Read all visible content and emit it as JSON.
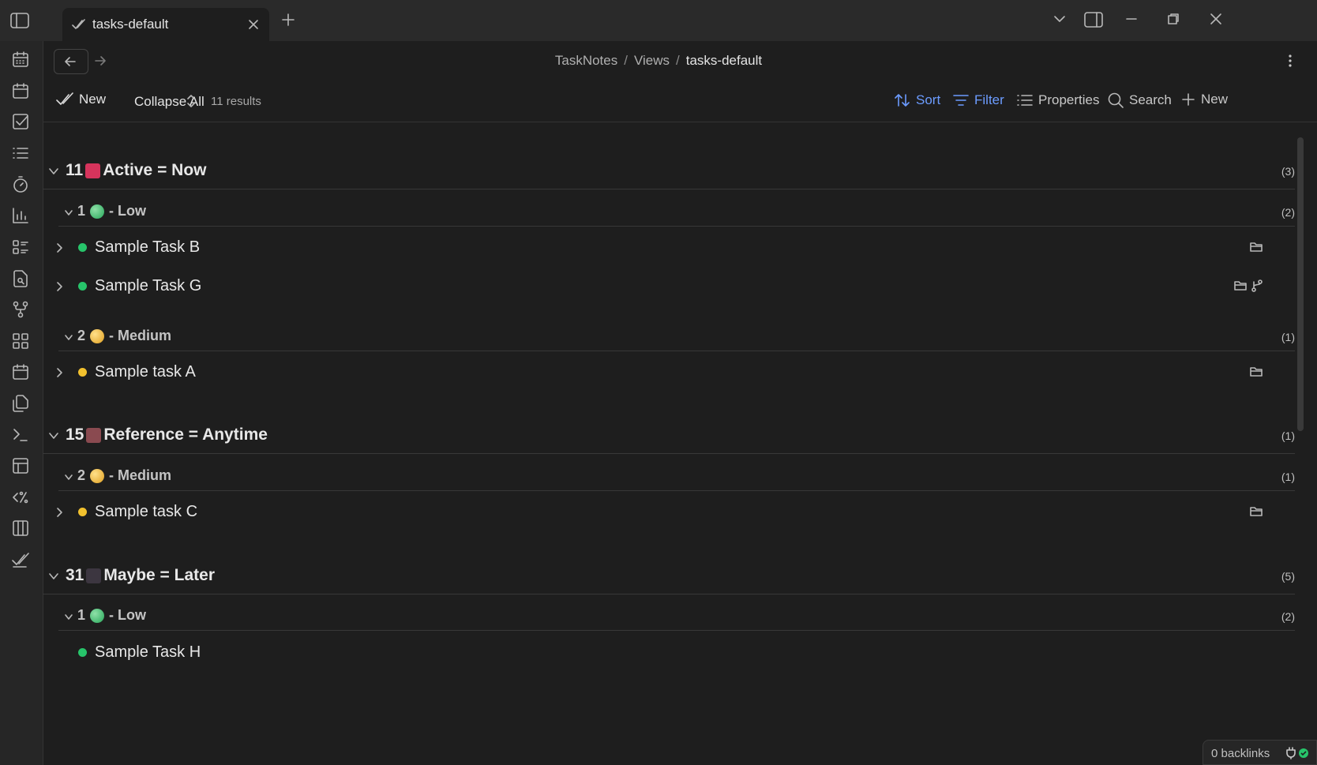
{
  "tab": {
    "title": "tasks-default"
  },
  "breadcrumb": {
    "root": "TaskNotes",
    "folder": "Views",
    "current": "tasks-default",
    "separator": "/"
  },
  "toolbar": {
    "new_label": "New",
    "collapse_label": "Collapse All",
    "results": "11 results",
    "sort_label": "Sort",
    "filter_label": "Filter",
    "properties_label": "Properties",
    "search_label": "Search",
    "new_right_label": "New"
  },
  "groups": [
    {
      "num": "11",
      "label": "Active = Now",
      "count": "(3)",
      "color": "#d6345c",
      "subgroups": [
        {
          "num": "1",
          "label": "- Low",
          "count": "(2)",
          "ball": "green",
          "tasks": [
            {
              "name": "Sample Task B",
              "dot": "green",
              "icons": [
                "folder-icon"
              ]
            },
            {
              "name": "Sample Task G",
              "dot": "green",
              "icons": [
                "folder-icon",
                "dependency-icon"
              ]
            }
          ]
        },
        {
          "num": "2",
          "label": "- Medium",
          "count": "(1)",
          "ball": "yellow",
          "tasks": [
            {
              "name": "Sample task A",
              "dot": "yellow",
              "icons": [
                "folder-icon"
              ]
            }
          ]
        }
      ]
    },
    {
      "num": "15",
      "label": "Reference = Anytime",
      "count": "(1)",
      "color": "#8a4a50",
      "subgroups": [
        {
          "num": "2",
          "label": "- Medium",
          "count": "(1)",
          "ball": "yellow",
          "tasks": [
            {
              "name": "Sample task C",
              "dot": "yellow",
              "icons": [
                "folder-icon"
              ]
            }
          ]
        }
      ]
    },
    {
      "num": "31",
      "label": "Maybe = Later",
      "count": "(5)",
      "color": "#3c3640",
      "subgroups": [
        {
          "num": "1",
          "label": "- Low",
          "count": "(2)",
          "ball": "green",
          "tasks": [
            {
              "name": "Sample Task H",
              "dot": "green",
              "icons": []
            }
          ]
        }
      ]
    }
  ],
  "status": {
    "backlinks": "0 backlinks"
  },
  "colors": {
    "accent": "#6c9cff",
    "green": "#27c46a",
    "yellow": "#f2c12e"
  },
  "ribbon_icons": [
    "calendar-icon",
    "calendar-icon",
    "checkbox-icon",
    "list-icon",
    "timer-icon",
    "bar-chart-icon",
    "task-list-icon",
    "file-search-icon",
    "git-fork-icon",
    "dashboard-icon",
    "calendar-icon",
    "files-icon",
    "terminal-icon",
    "table-icon",
    "percent-code-icon",
    "columns-icon",
    "tasknotes-icon"
  ]
}
